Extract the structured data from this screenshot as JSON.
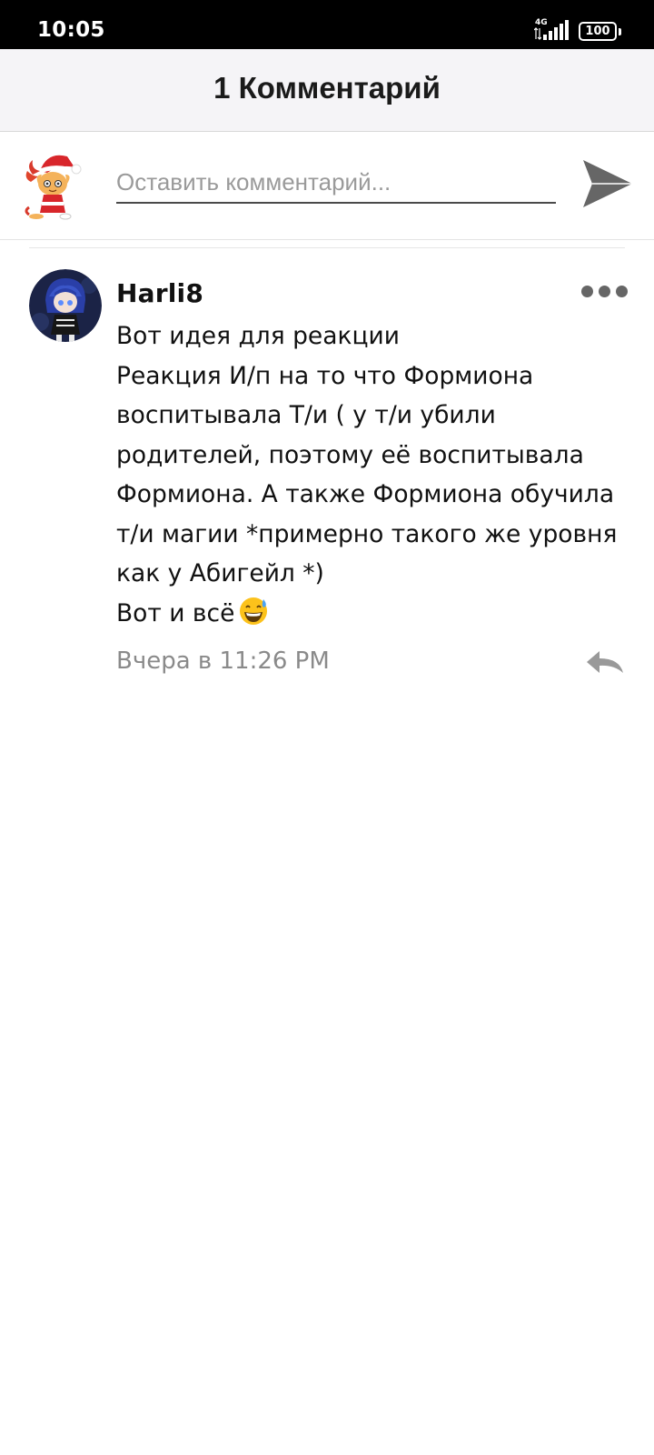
{
  "status_bar": {
    "time": "10:05",
    "network": "4G",
    "battery": "100"
  },
  "header": {
    "title": "1 Комментарий"
  },
  "compose": {
    "placeholder": "Оставить комментарий...",
    "avatar_icon": "santa-cat-avatar-icon",
    "send_icon": "send-arrow-icon"
  },
  "comments": [
    {
      "author": "Harli8",
      "lines": [
        "Вот идея для реакции",
        "Реакция И/п на то что Формиона",
        "воспитывала Т/и ( у т/и убили",
        "родителей, поэтому её воспитывала",
        "Формиона. А также Формиона обучила",
        "т/и магии *примерно такого же уровня",
        "как у Абигейл *)",
        "Вот и всё"
      ],
      "emoji": "grinning-sweat-emoji",
      "timestamp": "Вчера в 11:26 PM"
    }
  ],
  "colors": {
    "status_bar_bg": "#000000",
    "header_bg": "#f5f4f7",
    "icon_gray": "#666666",
    "timestamp_gray": "#8a8a8a"
  }
}
